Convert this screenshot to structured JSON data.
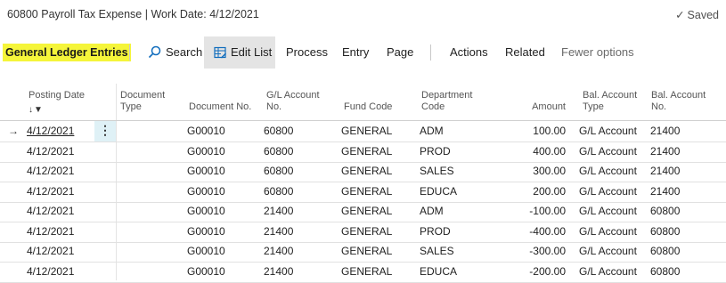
{
  "header": {
    "title": "60800 Payroll Tax Expense | Work Date: 4/12/2021",
    "saved_label": "Saved"
  },
  "actionbar": {
    "page_name": "General Ledger Entries",
    "search_label": "Search",
    "edit_list_label": "Edit List",
    "process_label": "Process",
    "entry_label": "Entry",
    "page_label": "Page",
    "actions_label": "Actions",
    "related_label": "Related",
    "fewer_options_label": "Fewer options"
  },
  "table": {
    "columns": {
      "posting_date": "Posting Date",
      "document_type_l1": "Document",
      "document_type_l2": "Type",
      "document_no": "Document No.",
      "gl_account_l1": "G/L Account",
      "gl_account_l2": "No.",
      "fund_code": "Fund Code",
      "department_l1": "Department",
      "department_l2": "Code",
      "amount": "Amount",
      "bal_type_l1": "Bal. Account",
      "bal_type_l2": "Type",
      "bal_no_l1": "Bal. Account",
      "bal_no_l2": "No."
    },
    "sort_indicator": "↓▼",
    "selected_marker": "→",
    "row_menu_glyph": "⋮",
    "rows": [
      {
        "posting_date": "4/12/2021",
        "document_no": "G00010",
        "gl_account": "60800",
        "fund_code": "GENERAL",
        "department": "ADM",
        "amount": "100.00",
        "bal_type": "G/L Account",
        "bal_no": "21400"
      },
      {
        "posting_date": "4/12/2021",
        "document_no": "G00010",
        "gl_account": "60800",
        "fund_code": "GENERAL",
        "department": "PROD",
        "amount": "400.00",
        "bal_type": "G/L Account",
        "bal_no": "21400"
      },
      {
        "posting_date": "4/12/2021",
        "document_no": "G00010",
        "gl_account": "60800",
        "fund_code": "GENERAL",
        "department": "SALES",
        "amount": "300.00",
        "bal_type": "G/L Account",
        "bal_no": "21400"
      },
      {
        "posting_date": "4/12/2021",
        "document_no": "G00010",
        "gl_account": "60800",
        "fund_code": "GENERAL",
        "department": "EDUCA",
        "amount": "200.00",
        "bal_type": "G/L Account",
        "bal_no": "21400"
      },
      {
        "posting_date": "4/12/2021",
        "document_no": "G00010",
        "gl_account": "21400",
        "fund_code": "GENERAL",
        "department": "ADM",
        "amount": "-100.00",
        "bal_type": "G/L Account",
        "bal_no": "60800"
      },
      {
        "posting_date": "4/12/2021",
        "document_no": "G00010",
        "gl_account": "21400",
        "fund_code": "GENERAL",
        "department": "PROD",
        "amount": "-400.00",
        "bal_type": "G/L Account",
        "bal_no": "60800"
      },
      {
        "posting_date": "4/12/2021",
        "document_no": "G00010",
        "gl_account": "21400",
        "fund_code": "GENERAL",
        "department": "SALES",
        "amount": "-300.00",
        "bal_type": "G/L Account",
        "bal_no": "60800"
      },
      {
        "posting_date": "4/12/2021",
        "document_no": "G00010",
        "gl_account": "21400",
        "fund_code": "GENERAL",
        "department": "EDUCA",
        "amount": "-200.00",
        "bal_type": "G/L Account",
        "bal_no": "60800"
      }
    ]
  }
}
